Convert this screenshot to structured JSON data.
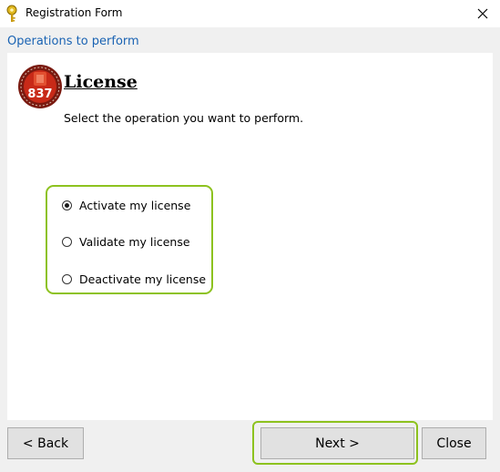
{
  "window": {
    "title": "Registration Form",
    "icon": "key-icon",
    "close_icon": "close-icon"
  },
  "header": {
    "text": "Operations to perform",
    "color": "#1a63b3"
  },
  "panel": {
    "badge_text": "837",
    "heading": "License",
    "instruction": "Select the operation you want to perform.",
    "options": [
      {
        "label": "Activate my license",
        "selected": true
      },
      {
        "label": "Validate my license",
        "selected": false
      },
      {
        "label": "Deactivate my license",
        "selected": false
      }
    ]
  },
  "buttons": {
    "back": "< Back",
    "next": "Next >",
    "close": "Close"
  },
  "accent_color": "#8dc21f"
}
